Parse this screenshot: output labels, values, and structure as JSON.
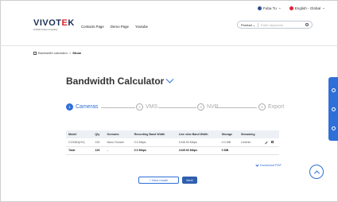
{
  "utility": {
    "user": "Fuba Tu",
    "language": "English - Global"
  },
  "header": {
    "logo_main": "VIVOTEK",
    "logo_sub": "A Delta Group Company",
    "nav": [
      "Contacts Page",
      "Demo Page",
      "Youtube"
    ],
    "search_product": "Product",
    "search_placeholder": "Enter keywords"
  },
  "breadcrumb": {
    "parent": "Bandwidth calculator",
    "separator": ">",
    "current": "Show"
  },
  "title": "Bandwidth Calculator",
  "steps": [
    {
      "num": "1",
      "label": "Cameras",
      "active": true
    },
    {
      "num": "2",
      "label": "VMS",
      "active": false
    },
    {
      "num": "3",
      "label": "NVR",
      "active": false
    },
    {
      "num": "4",
      "label": "Export",
      "active": false
    }
  ],
  "table": {
    "headers": [
      "Model",
      "Qty",
      "Scenario",
      "Recording Band Width",
      "Live view Band Width",
      "Storage",
      "Streaming",
      ""
    ],
    "rows": [
      [
        "CC9381(HV)",
        "125",
        "Mono Sunset",
        "0.0 Mbps",
        "1045.93 Mbps",
        "0.0 MB",
        "Livemin"
      ]
    ],
    "total": [
      "Total",
      "125",
      "-",
      "0.0 Mbps",
      "1045.93 Mbps",
      "0 MB"
    ]
  },
  "download_label": "Download PDF",
  "buttons": {
    "new_model": "+ New model",
    "next": "Next"
  },
  "colors": {
    "accent": "#2f6fd8",
    "brand": "#1a2c55",
    "brand_red": "#d8232a"
  }
}
